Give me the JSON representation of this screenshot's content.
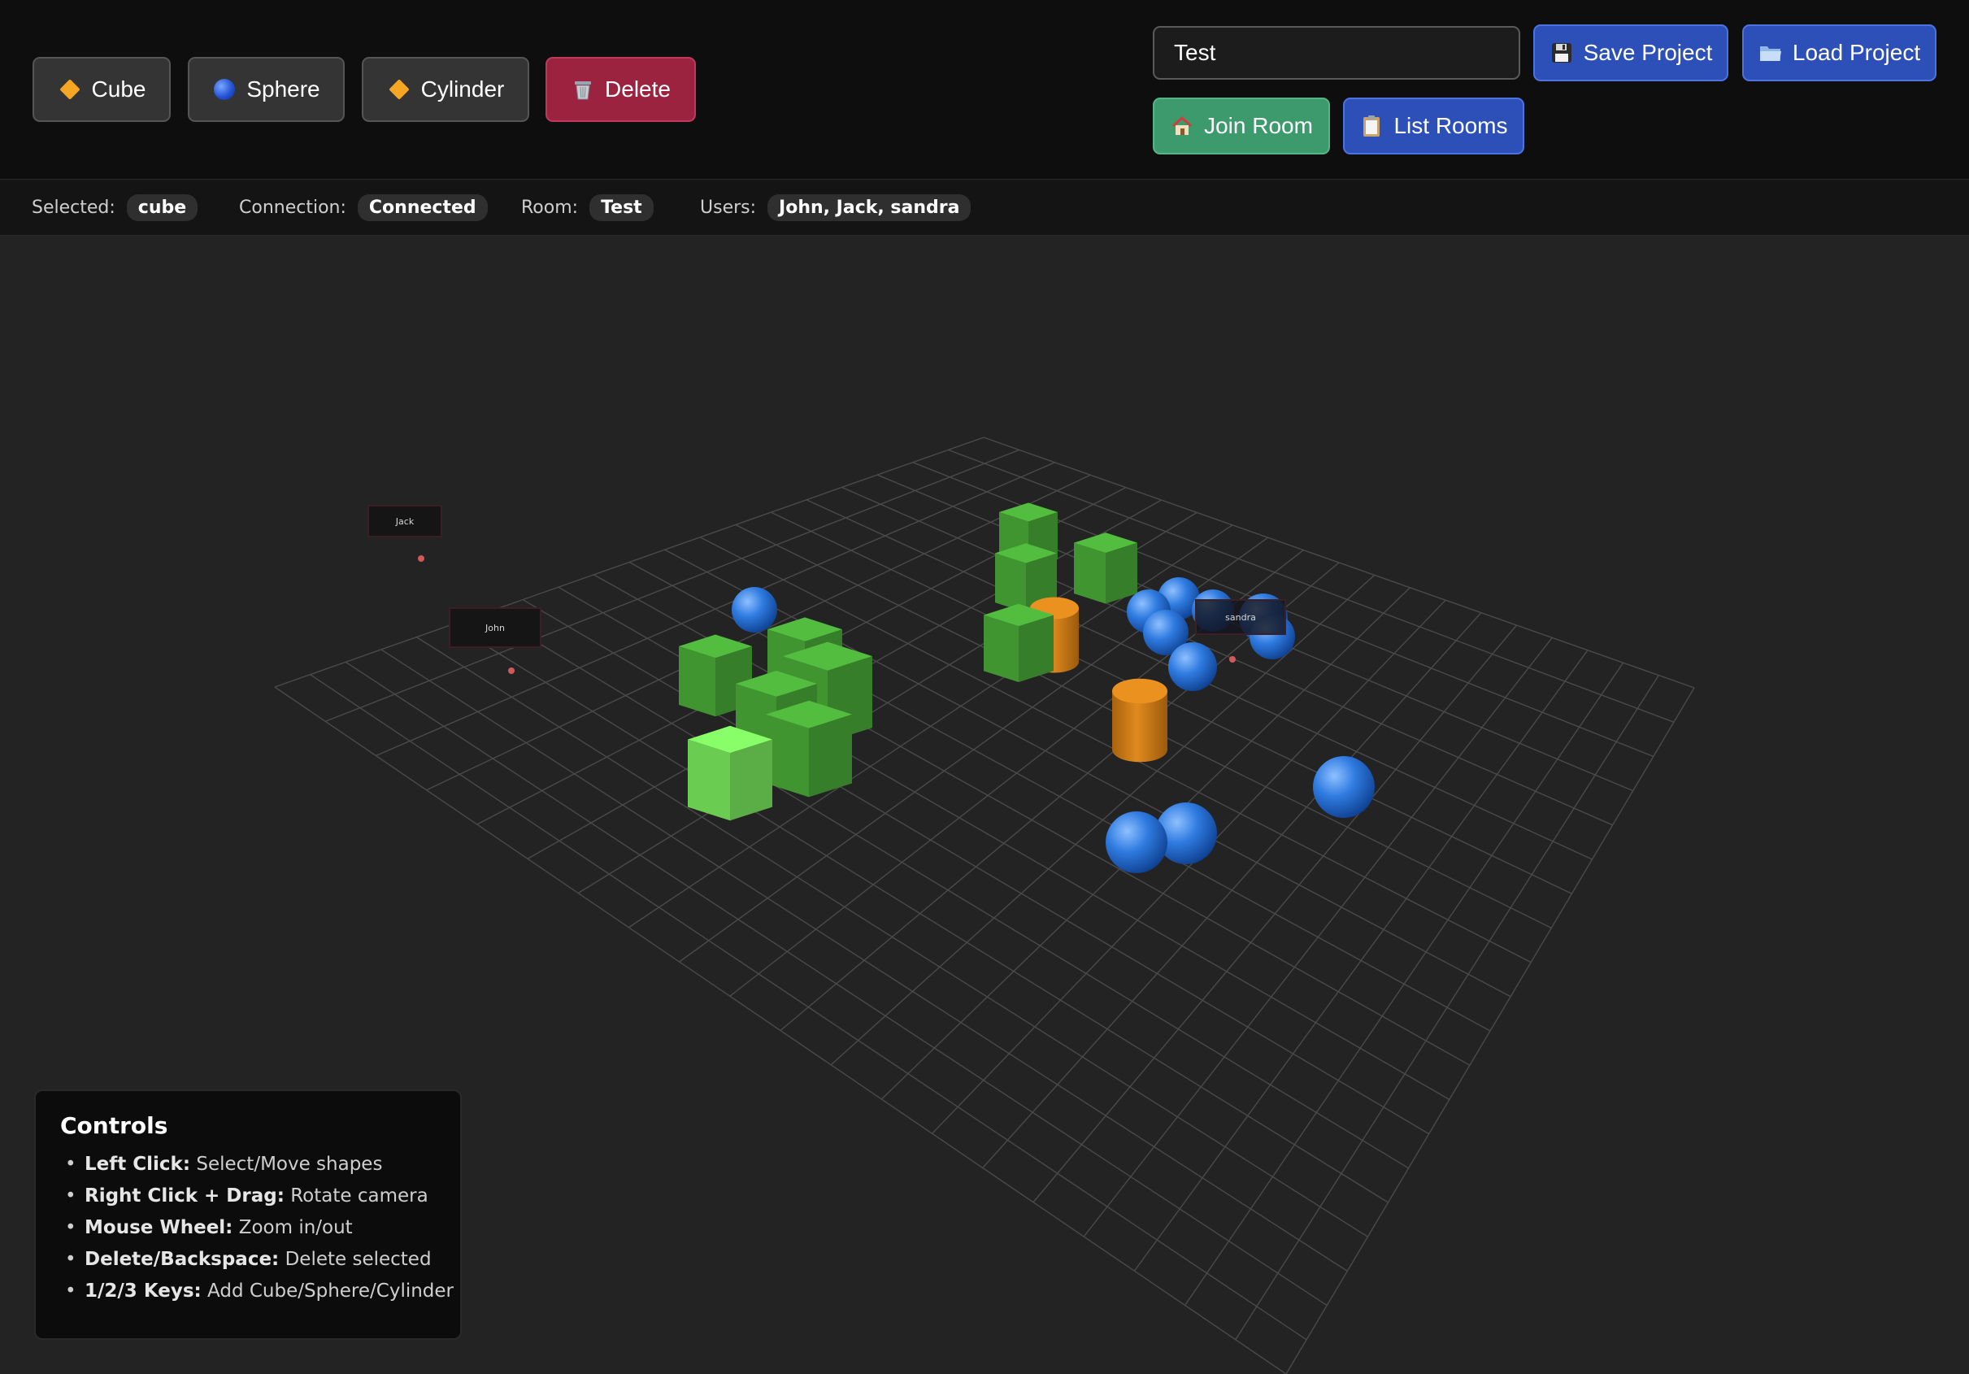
{
  "toolbar": {
    "add_cube_label": "Cube",
    "add_sphere_label": "Sphere",
    "add_cylinder_label": "Cylinder",
    "delete_label": "Delete",
    "room_input_value": "Test",
    "save_project_label": "Save Project",
    "load_project_label": "Load Project",
    "join_room_label": "Join Room",
    "list_rooms_label": "List Rooms"
  },
  "icons": {
    "cube": "orange-diamond-icon",
    "sphere": "blue-circle-icon",
    "cylinder": "orange-diamond-icon",
    "delete": "wastebasket-icon",
    "save": "floppy-disk-icon",
    "load": "folder-icon",
    "join": "house-icon",
    "list": "clipboard-icon"
  },
  "status": {
    "selected_label": "Selected:",
    "selected_value": "cube",
    "connection_label": "Connection:",
    "connection_value": "Connected",
    "room_label": "Room:",
    "room_value": "Test",
    "users_label": "Users:",
    "users_value": "John, Jack, sandra"
  },
  "scene": {
    "user_markers": [
      "Jack",
      "John",
      "sandra"
    ],
    "colors": {
      "cube": "#4caf3a",
      "cube_selected": "#7ef060",
      "sphere": "#2f7be0",
      "cylinder": "#e08a1e",
      "grid": "#4a4a4a"
    }
  },
  "controls": {
    "title": "Controls",
    "items": [
      {
        "key": "Left Click:",
        "desc": "Select/Move shapes"
      },
      {
        "key": "Right Click + Drag:",
        "desc": "Rotate camera"
      },
      {
        "key": "Mouse Wheel:",
        "desc": "Zoom in/out"
      },
      {
        "key": "Delete/Backspace:",
        "desc": "Delete selected"
      },
      {
        "key": "1/2/3 Keys:",
        "desc": "Add Cube/Sphere/Cylinder"
      }
    ]
  }
}
